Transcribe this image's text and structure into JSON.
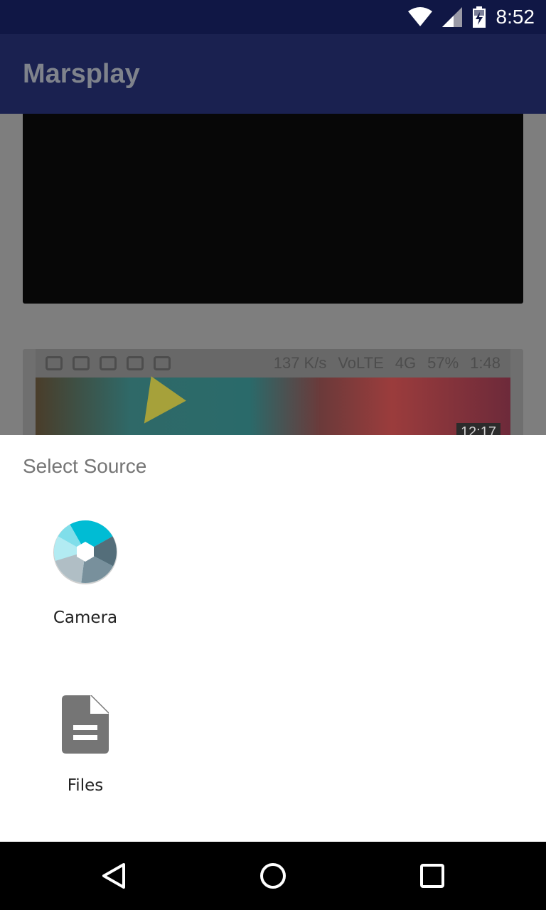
{
  "status_bar": {
    "time": "8:52"
  },
  "app_bar": {
    "title": "Marsplay"
  },
  "background": {
    "thumbnail": {
      "status_speed": "137 K/s",
      "status_volte": "VoLTE",
      "status_network": "4G",
      "status_battery": "57%",
      "status_time": "1:48",
      "duration": "12:17"
    }
  },
  "sheet": {
    "title": "Select Source",
    "options": [
      {
        "label": "Camera",
        "icon": "camera-shutter-icon"
      },
      {
        "label": "Files",
        "icon": "file-document-icon"
      }
    ]
  },
  "nav_bar": {
    "buttons": [
      "back-icon",
      "home-icon",
      "recents-icon"
    ]
  },
  "colors": {
    "status_bar": "#101745",
    "app_bar": "#1a2150",
    "sheet_bg": "#ffffff",
    "scrim": "#7e7e7e",
    "nav_bar": "#000000",
    "file_icon": "#757575"
  }
}
